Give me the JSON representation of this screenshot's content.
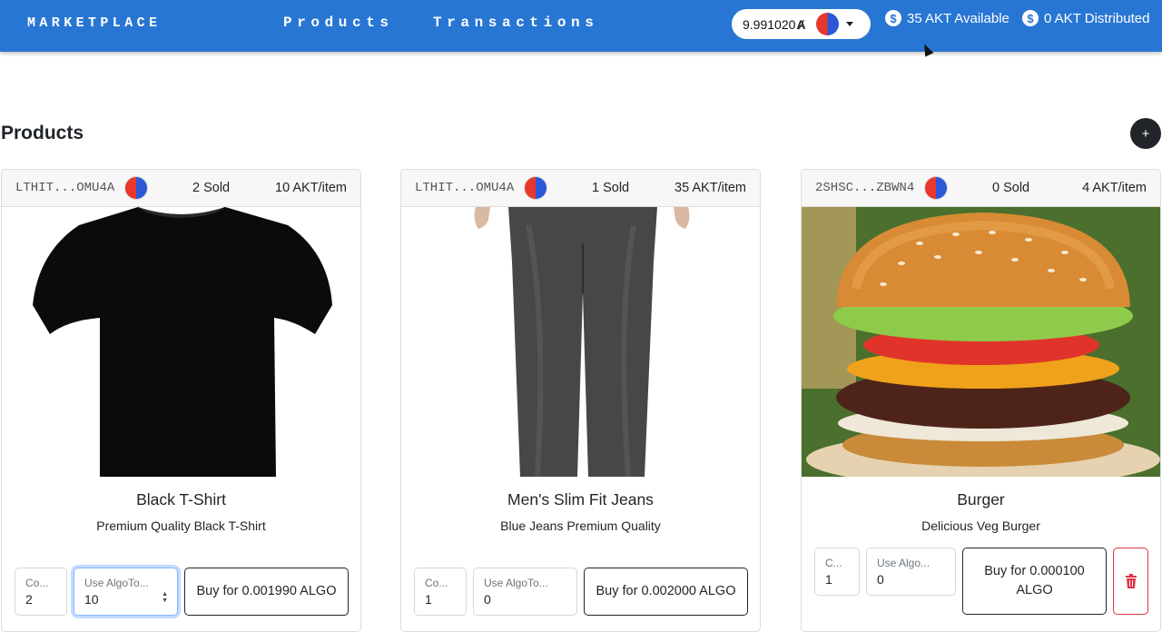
{
  "nav": {
    "brand": "MARKETPLACE",
    "links": [
      "Products",
      "Transactions"
    ],
    "wallet_balance": "9.991020",
    "algo_symbol": "Ⱥ",
    "available": "35 AKT Available",
    "distributed": "0 AKT Distributed",
    "coin_symbol": "$"
  },
  "page": {
    "title": "Products",
    "add_symbol": "+"
  },
  "products": [
    {
      "address": "LTHIT...OMU4A",
      "sold": "2 Sold",
      "price": "10 AKT/item",
      "name": "Black T-Shirt",
      "description": "Premium Quality Black T-Shirt",
      "count_label": "Co...",
      "count_value": "2",
      "token_label": "Use AlgoTo...",
      "token_value": "10",
      "buy_label": "Buy for 0.001990 ALGO"
    },
    {
      "address": "LTHIT...OMU4A",
      "sold": "1 Sold",
      "price": "35 AKT/item",
      "name": "Men's Slim Fit Jeans",
      "description": "Blue Jeans Premium Quality",
      "count_label": "Co...",
      "count_value": "1",
      "token_label": "Use AlgoTo...",
      "token_value": "0",
      "buy_label": "Buy for 0.002000 ALGO"
    },
    {
      "address": "2SHSC...ZBWN4",
      "sold": "0 Sold",
      "price": "4 AKT/item",
      "name": "Burger",
      "description": "Delicious Veg Burger",
      "count_label": "C...",
      "count_value": "1",
      "token_label": "Use Algo...",
      "token_value": "0",
      "buy_label": "Buy for 0.000100 ALGO"
    }
  ],
  "colors": {
    "navbar": "#2876d3",
    "danger": "#dc3545",
    "dark": "#212529"
  }
}
